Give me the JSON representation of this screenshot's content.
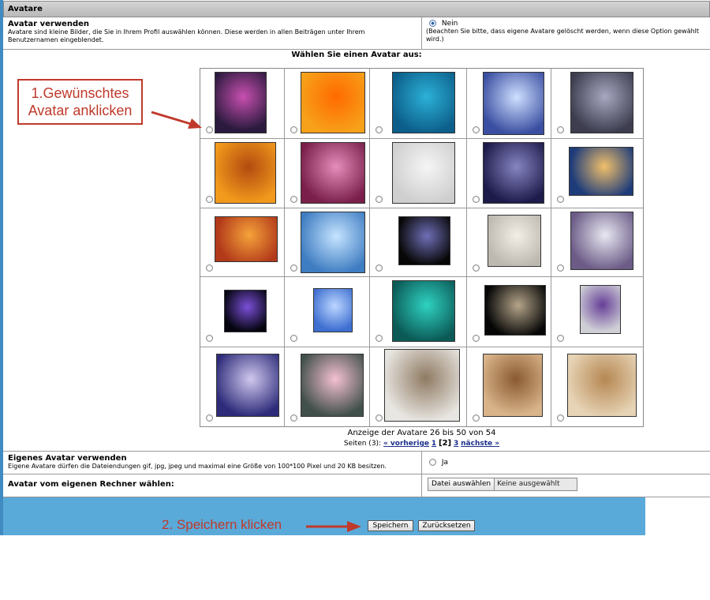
{
  "section": {
    "title": "Avatare"
  },
  "use_avatar": {
    "label": "Avatar verwenden",
    "description": "Avatare sind kleine Bilder, die Sie in Ihrem Profil auswählen können. Diese werden in allen Beiträgen unter Ihrem Benutzernamen eingeblendet.",
    "option_label": "Nein",
    "option_note": "(Beachten Sie bitte, dass eigene Avatare gelöscht werden, wenn diese Option gewählt wird.)"
  },
  "choose_title": "Wählen Sie einen Avatar aus:",
  "avatars": [
    {
      "name": "avatar-moon-tree"
    },
    {
      "name": "avatar-orange-lily"
    },
    {
      "name": "avatar-frangipani"
    },
    {
      "name": "avatar-fairy-blue"
    },
    {
      "name": "avatar-celtic-knot"
    },
    {
      "name": "avatar-sunset-tree"
    },
    {
      "name": "avatar-pink-woman"
    },
    {
      "name": "avatar-white-sun"
    },
    {
      "name": "avatar-wizard"
    },
    {
      "name": "avatar-ocean-waves"
    },
    {
      "name": "avatar-orange-sunset"
    },
    {
      "name": "avatar-glass-fairy"
    },
    {
      "name": "avatar-dark-fairy"
    },
    {
      "name": "avatar-puppy"
    },
    {
      "name": "avatar-white-hair-woman"
    },
    {
      "name": "avatar-butterfly-fairy"
    },
    {
      "name": "avatar-blue-fairy"
    },
    {
      "name": "avatar-fractal"
    },
    {
      "name": "avatar-eagle"
    },
    {
      "name": "avatar-pegasus"
    },
    {
      "name": "avatar-dove"
    },
    {
      "name": "avatar-water-lily"
    },
    {
      "name": "avatar-kitten"
    },
    {
      "name": "avatar-kittens-basket"
    },
    {
      "name": "avatar-sleeping-puppy"
    }
  ],
  "pagination": {
    "summary": "Anzeige der Avatare 26 bis 50 von 54",
    "pages_prefix": "Seiten (3):",
    "prev": "« vorherige",
    "page1": "1",
    "current": "[2]",
    "page3": "3",
    "next": "nächste »"
  },
  "own_avatar": {
    "label": "Eigenes Avatar verwenden",
    "description": "Eigene Avatare dürfen die Dateiendungen gif, jpg, jpeg und maximal eine Größe von 100*100 Pixel und 20 KB besitzen.",
    "option_label": "Ja"
  },
  "upload": {
    "label": "Avatar vom eigenen Rechner wählen:",
    "button": "Datei auswählen",
    "status": "Keine ausgewählt"
  },
  "buttons": {
    "save": "Speichern",
    "reset": "Zurücksetzen"
  },
  "annotations": {
    "step1_line1": "1.Gewünschtes",
    "step1_line2": "Avatar anklicken",
    "step2": "2. Speichern klicken"
  },
  "colors": {
    "footer": "#5aaad9",
    "annotation": "#c0392b",
    "link": "#1b2e8c"
  }
}
